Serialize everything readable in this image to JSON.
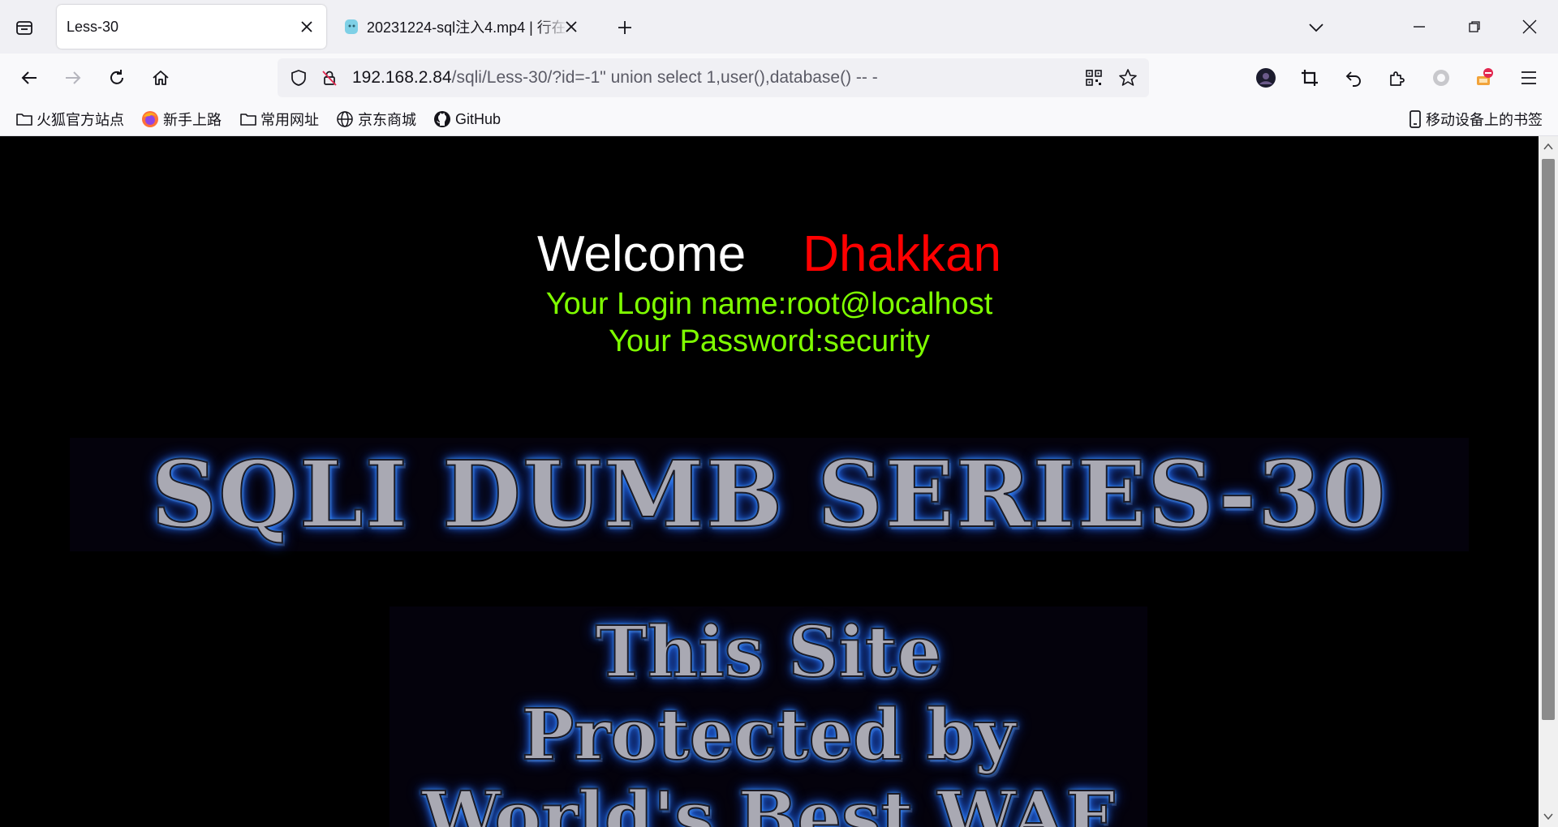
{
  "browser": {
    "tabs": [
      {
        "label": "Less-30",
        "active": true
      },
      {
        "label": "20231224-sql注入4.mp4 | 行在",
        "active": false
      }
    ],
    "url": {
      "host": "192.168.2.84",
      "path": "/sqli/Less-30/?id=-1\" union select 1,user(),database() -- -"
    },
    "bookmarks": [
      {
        "label": "火狐官方站点",
        "icon": "folder-icon"
      },
      {
        "label": "新手上路",
        "icon": "firefox-icon"
      },
      {
        "label": "常用网址",
        "icon": "folder-icon"
      },
      {
        "label": "京东商城",
        "icon": "globe-icon"
      },
      {
        "label": "GitHub",
        "icon": "github-icon"
      }
    ],
    "mobile_bookmarks": "移动设备上的书签"
  },
  "page": {
    "welcome": "Welcome",
    "username": "Dhakkan",
    "login_name": "Your Login name:root@localhost",
    "password": "Your Password:security",
    "banner_title": "SQLI DUMB SERIES-30",
    "waf_lines": [
      "This Site",
      "Protected by",
      "World's Best WAF"
    ]
  },
  "colors": {
    "page_bg": "#000000",
    "welcome": "#ffffff",
    "username": "#ff0000",
    "credentials": "#7fff00",
    "glow": "#2a7fff"
  }
}
